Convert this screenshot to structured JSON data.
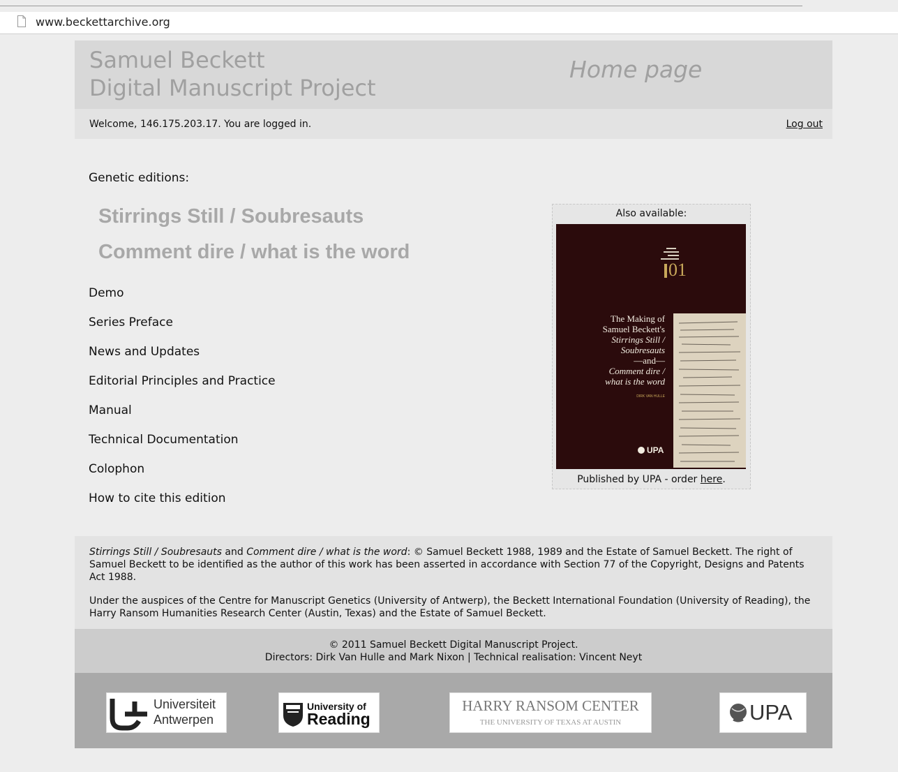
{
  "browser": {
    "url": "www.beckettarchive.org"
  },
  "header": {
    "title_line1": "Samuel Beckett",
    "title_line2": "Digital Manuscript Project",
    "page_heading": "Home page"
  },
  "welcome": {
    "text": "Welcome, 146.175.203.17. You are logged in.",
    "logout": "Log out"
  },
  "main": {
    "genetic_label": "Genetic editions:",
    "editions": [
      "Stirrings Still / Soubresauts",
      "Comment dire / what is the word"
    ],
    "nav": [
      "Demo",
      "Series Preface",
      "News and Updates",
      "Editorial Principles and Practice",
      "Manual",
      "Technical Documentation",
      "Colophon",
      "How to cite this edition"
    ]
  },
  "also_available": {
    "title": "Also available:",
    "cover": {
      "number": "01",
      "lines": [
        "The Making of",
        "Samuel Beckett's",
        "Stirrings Still /",
        "Soubresauts",
        "—and—",
        "Comment dire /",
        "what is the word"
      ],
      "author": "DIRK VAN HULLE",
      "publisher": "UPA"
    },
    "footer_prefix": "Published by UPA - order ",
    "footer_link": "here",
    "footer_suffix": "."
  },
  "copyright": {
    "italic1": "Stirrings Still / Soubresauts",
    "and": " and ",
    "italic2": "Comment dire / what is the word",
    "rest": ": © Samuel Beckett 1988, 1989 and the Estate of Samuel Beckett. The right of Samuel Beckett to be identified as the author of this work has been asserted in accordance with Section 77 of the Copyright, Designs and Patents Act 1988.",
    "auspices": "Under the auspices of the Centre for Manuscript Genetics (University of Antwerp), the Beckett International Foundation (University of Reading), the Harry Ransom Humanities Research Center (Austin, Texas) and the Estate of Samuel Beckett."
  },
  "credits": {
    "line1": "© 2011 Samuel Beckett Digital Manuscript Project.",
    "line2": "Directors: Dirk Van Hulle and Mark Nixon | Technical realisation: Vincent Neyt"
  },
  "logos": {
    "antwerp": [
      "Universiteit",
      "Antwerpen"
    ],
    "reading": [
      "University of",
      "Reading"
    ],
    "ransom": [
      "HARRY RANSOM CENTER",
      "THE UNIVERSITY OF TEXAS AT AUSTIN"
    ],
    "upa": "UPA"
  }
}
